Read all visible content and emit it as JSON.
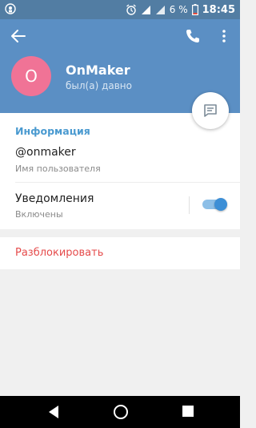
{
  "status_bar": {
    "battery_percent": "6 %",
    "time": "18:45",
    "icons": [
      "alarm-icon",
      "signal-icon",
      "wifi-icon",
      "battery-icon"
    ]
  },
  "header": {
    "back_icon": "arrow-left-icon",
    "call_icon": "phone-icon",
    "more_icon": "more-vertical-icon",
    "avatar_letter": "O",
    "avatar_color": "#f07396",
    "name": "OnMaker",
    "status": "был(а) давно",
    "header_color": "#5b8fc4"
  },
  "fab": {
    "icon": "message-icon"
  },
  "info": {
    "section_title": "Информация",
    "username": "@onmaker",
    "username_caption": "Имя пользователя",
    "notifications_title": "Уведомления",
    "notifications_state": "Включены",
    "notifications_on": true
  },
  "actions": {
    "unblock_label": "Разблокировать",
    "unblock_color": "#e54b4b"
  },
  "nav": {
    "icons": [
      "nav-back-icon",
      "nav-home-icon",
      "nav-recent-icon"
    ]
  }
}
